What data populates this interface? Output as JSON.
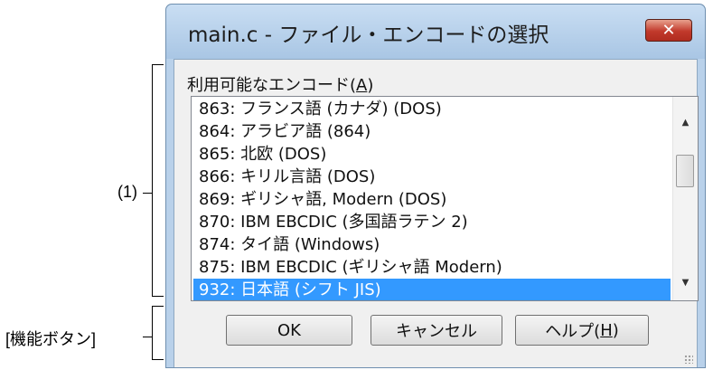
{
  "annotations": {
    "list_label": "(1)",
    "buttons_label": "[機能ボタン]"
  },
  "dialog": {
    "title": "main.c - ファイル・エンコードの選択",
    "close_icon": "close-icon",
    "encoding_label_prefix": "利用可能なエンコード(",
    "encoding_label_key": "A",
    "encoding_label_suffix": ")",
    "encodings": [
      "863: フランス語 (カナダ) (DOS)",
      "864: アラビア語 (864)",
      "865: 北欧 (DOS)",
      "866: キリル言語 (DOS)",
      "869: ギリシャ語, Modern (DOS)",
      "870: IBM EBCDIC (多国語ラテン 2)",
      "874: タイ語 (Windows)",
      "875: IBM EBCDIC (ギリシャ語 Modern)",
      "932: 日本語 (シフト JIS)"
    ],
    "selected_encoding": "932: 日本語 (シフト JIS)",
    "ok_label": "OK",
    "cancel_label": "キャンセル",
    "help_label_prefix": "ヘルプ(",
    "help_label_key": "H",
    "help_label_suffix": ")",
    "selection_color": "#3399ff"
  }
}
